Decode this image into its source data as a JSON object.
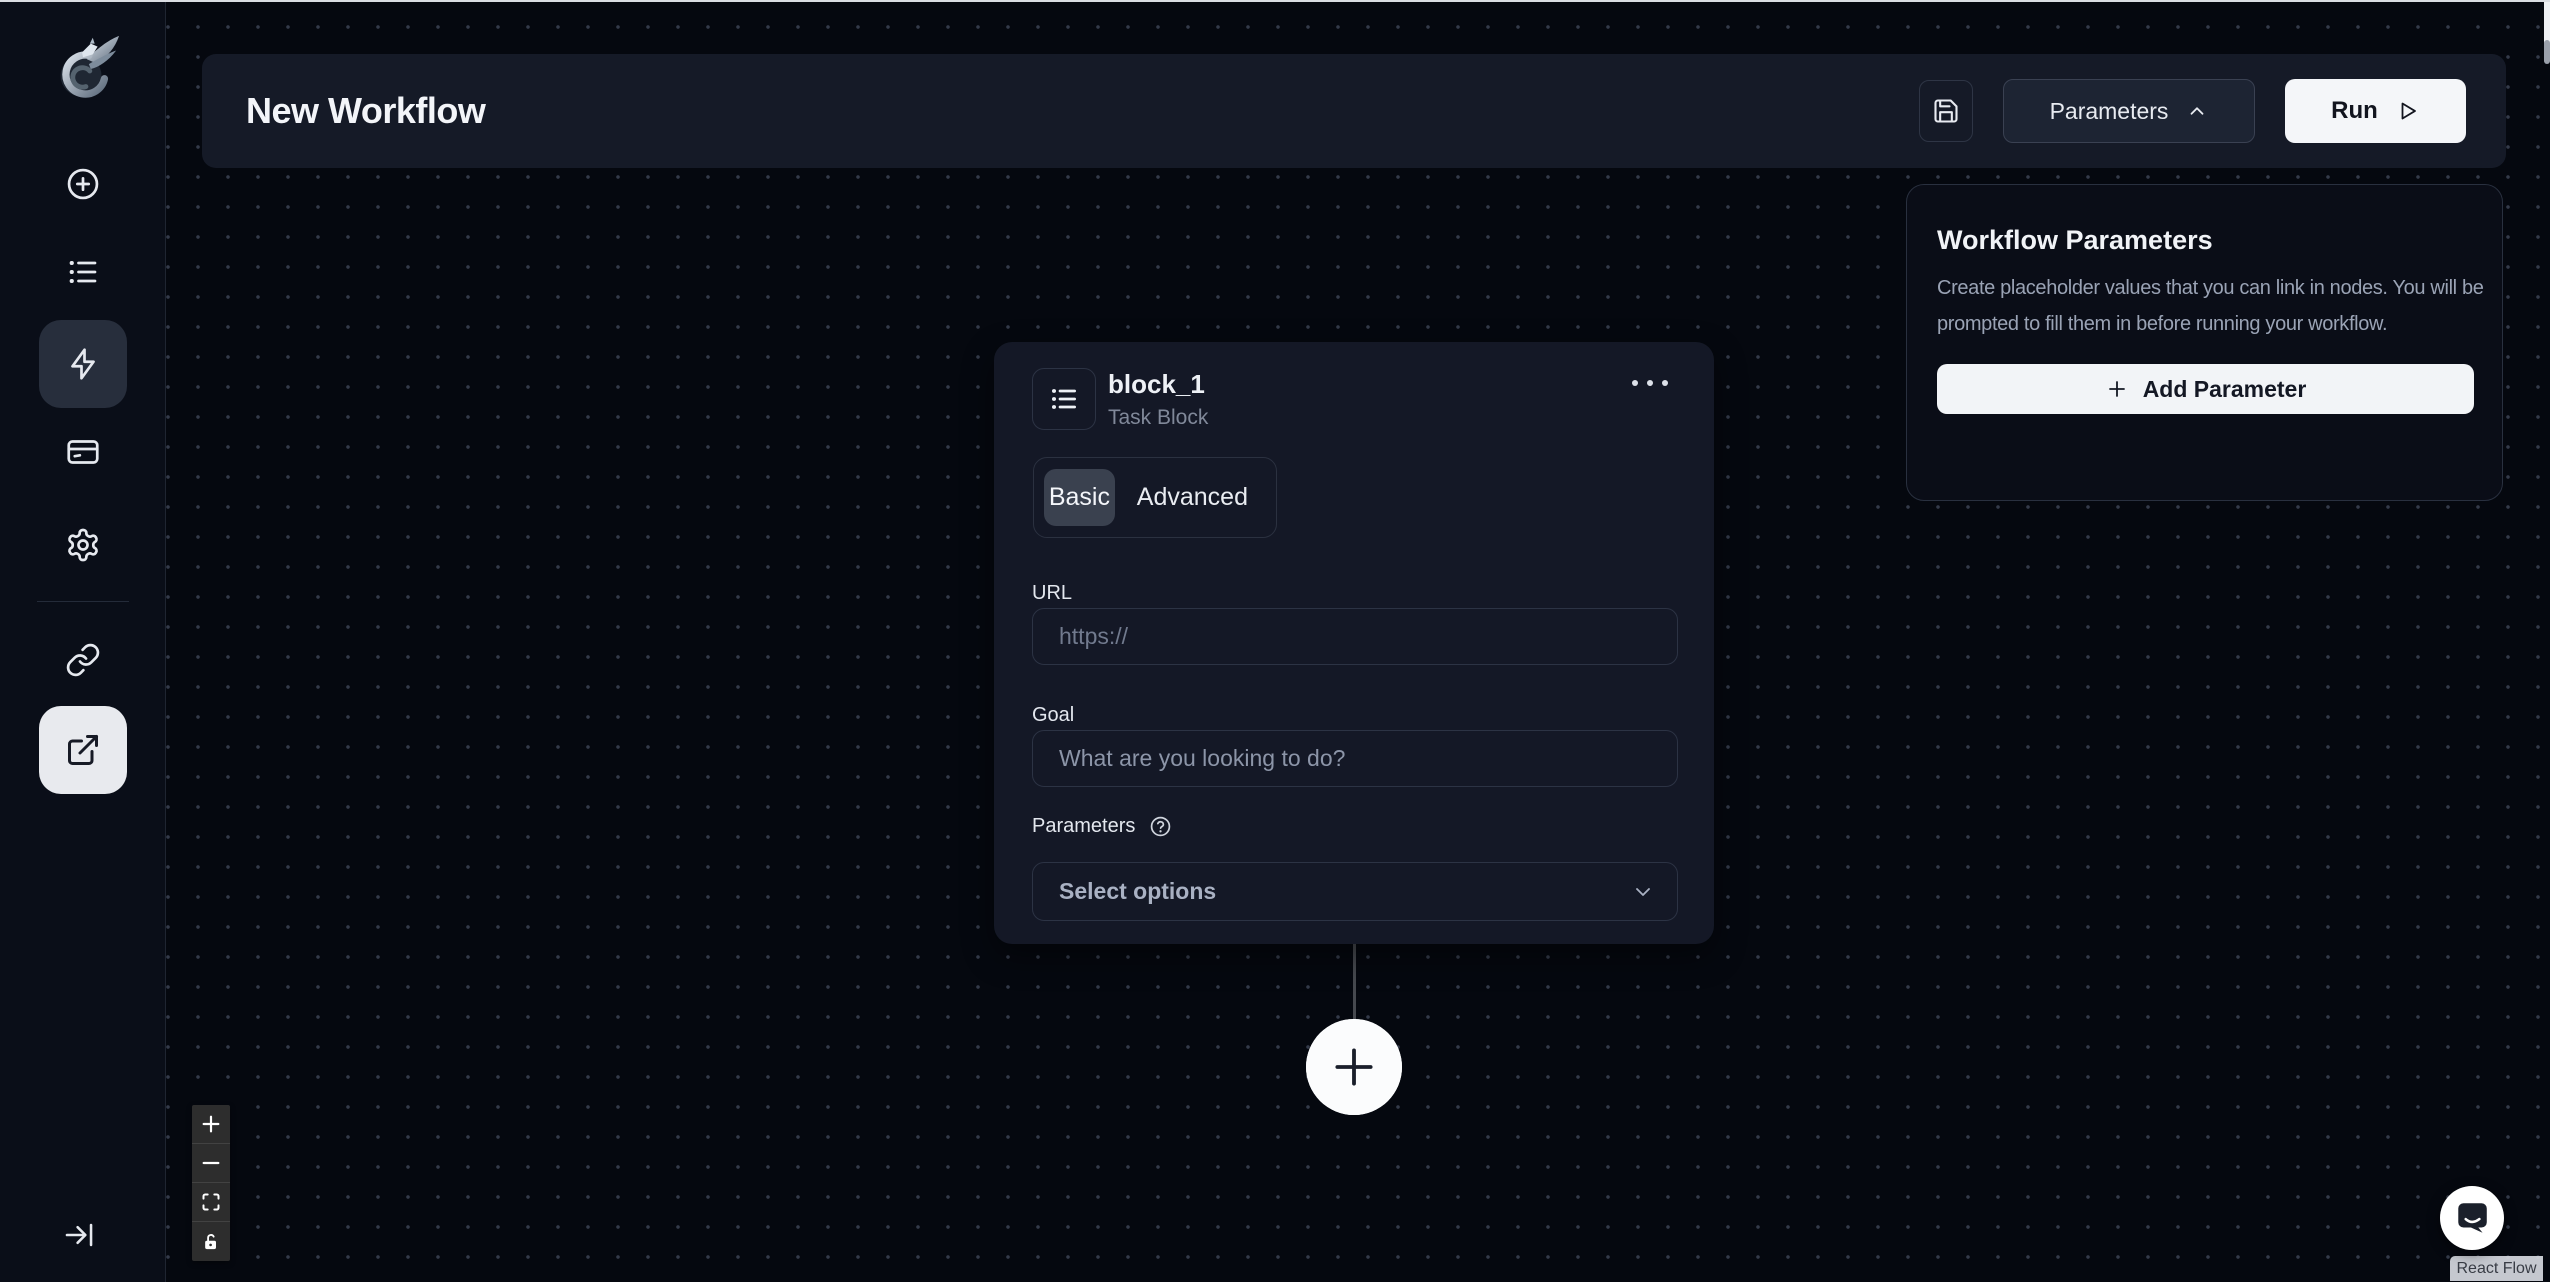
{
  "colors": {
    "canvas_bg": "#05080f",
    "sidebar_bg": "#0a0e18",
    "surface_bg": "#151a27",
    "border": "#2c3344",
    "muted_text": "#9aa3b5",
    "white_action": "#f4f6f9",
    "active_item_dark": "#272e3c",
    "active_item_light": "#e8eaee"
  },
  "sidebar": {
    "logo": "skyvern-dragon-logo",
    "items": [
      {
        "name": "create",
        "icon": "plus-circle-icon"
      },
      {
        "name": "tasks",
        "icon": "list-icon"
      },
      {
        "name": "workflows",
        "icon": "zap-icon",
        "active": true
      },
      {
        "name": "billing",
        "icon": "credit-card-icon"
      },
      {
        "name": "settings",
        "icon": "gear-icon"
      },
      {
        "name": "integrations",
        "icon": "link-icon"
      },
      {
        "name": "share",
        "icon": "external-link-icon",
        "active": true
      }
    ],
    "collapse_icon": "arrow-right-to-line-icon"
  },
  "header": {
    "title": "New Workflow",
    "save_icon": "floppy-disk-icon",
    "parameters_button": "Parameters",
    "parameters_chevron": "chevron-up-icon",
    "run_button": "Run",
    "run_icon": "play-icon"
  },
  "parameters_panel": {
    "title": "Workflow Parameters",
    "description": "Create placeholder values that you can link in nodes. You will be prompted to fill them in before running your workflow.",
    "add_button": "Add Parameter"
  },
  "node": {
    "title": "block_1",
    "subtitle": "Task Block",
    "menu_icon": "ellipsis-icon",
    "tabs": {
      "basic": "Basic",
      "advanced": "Advanced",
      "selected": "Basic"
    },
    "url_label": "URL",
    "url_value": "",
    "url_placeholder": "https://",
    "goal_label": "Goal",
    "goal_value": "",
    "goal_placeholder": "What are you looking to do?",
    "parameters_label": "Parameters",
    "help_icon": "help-circle-icon",
    "select_placeholder": "Select options",
    "select_chevron": "chevron-down-icon"
  },
  "canvas": {
    "controls": [
      "zoom-in",
      "zoom-out",
      "fit-view",
      "lock"
    ],
    "add_node_icon": "plus-icon",
    "chat_icon": "chat-bubble-icon",
    "attribution": "React Flow"
  }
}
